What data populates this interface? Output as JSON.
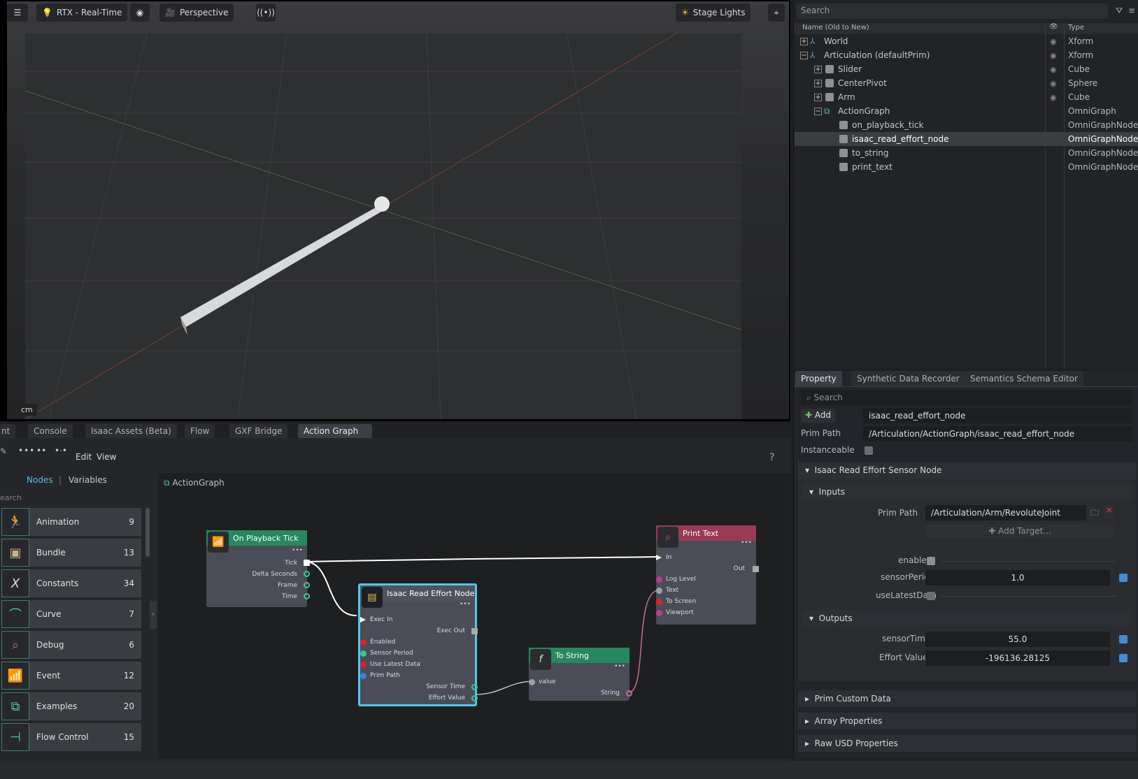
{
  "viewport": {
    "render_mode": "RTX - Real-Time",
    "camera": "Perspective",
    "lights": "Stage Lights",
    "unit": "cm"
  },
  "stage": {
    "search_placeholder": "Search",
    "col_name": "Name (Old to New)",
    "col_type": "Type",
    "rows": [
      {
        "name": "World",
        "type": "Xform"
      },
      {
        "name": "Articulation (defaultPrim)",
        "type": "Xform"
      },
      {
        "name": "Slider",
        "type": "Cube"
      },
      {
        "name": "CenterPivot",
        "type": "Sphere"
      },
      {
        "name": "Arm",
        "type": "Cube"
      },
      {
        "name": "ActionGraph",
        "type": "OmniGraph"
      },
      {
        "name": "on_playback_tick",
        "type": "OmniGraphNode"
      },
      {
        "name": "isaac_read_effort_node",
        "type": "OmniGraphNode"
      },
      {
        "name": "to_string",
        "type": "OmniGraphNode"
      },
      {
        "name": "print_text",
        "type": "OmniGraphNode"
      }
    ]
  },
  "property": {
    "tabs": [
      "Property",
      "Synthetic Data Recorder",
      "Semantics Schema Editor"
    ],
    "search_placeholder": "Search",
    "add_label": "Add",
    "name_value": "isaac_read_effort_node",
    "prim_path_label": "Prim Path",
    "prim_path_value": "/Articulation/ActionGraph/isaac_read_effort_node",
    "instanceable_label": "Instanceable",
    "section_title": "Isaac Read Effort Sensor Node",
    "inputs_label": "Inputs",
    "input_prim_path_label": "Prim Path",
    "input_prim_path_value": "/Articulation/Arm/RevoluteJoint",
    "add_target_label": "Add Target...",
    "enabled_label": "enabled",
    "sensor_period_label": "sensorPeriod",
    "sensor_period_value": "1.0",
    "use_latest_label": "useLatestData",
    "outputs_label": "Outputs",
    "sensor_time_label": "sensorTime",
    "sensor_time_value": "55.0",
    "effort_label": "Effort Value",
    "effort_value": "-196136.28125",
    "collapsed_sections": [
      "Prim Custom Data",
      "Array Properties",
      "Raw USD Properties"
    ]
  },
  "bottom_tabs": [
    "nt",
    "Console",
    "Isaac Assets (Beta)",
    "Flow",
    "GXF Bridge",
    "Action Graph"
  ],
  "graph_editor": {
    "menu_edit": "Edit",
    "menu_view": "View",
    "help": "?",
    "nodes_tab": "Nodes",
    "separator": "|",
    "variables_tab": "Variables",
    "search_placeholder": "earch",
    "breadcrumb": "ActionGraph",
    "categories": [
      {
        "name": "Animation",
        "count": "9",
        "icon": "running-person-icon"
      },
      {
        "name": "Bundle",
        "count": "13",
        "icon": "box-icon"
      },
      {
        "name": "Constants",
        "count": "34",
        "icon": "x-icon"
      },
      {
        "name": "Curve",
        "count": "7",
        "icon": "curve-icon"
      },
      {
        "name": "Debug",
        "count": "6",
        "icon": "bug-icon"
      },
      {
        "name": "Event",
        "count": "12",
        "icon": "signal-icon"
      },
      {
        "name": "Examples",
        "count": "20",
        "icon": "examples-icon"
      },
      {
        "name": "Flow Control",
        "count": "15",
        "icon": "flow-icon"
      }
    ],
    "nodes": {
      "tick": {
        "title": "On Playback Tick",
        "ports": [
          "Tick",
          "Delta Seconds",
          "Frame",
          "Time"
        ]
      },
      "effort": {
        "title": "Isaac Read Effort Node",
        "ins": [
          "Exec In",
          "Enabled",
          "Sensor Period",
          "Use Latest Data",
          "Prim Path"
        ],
        "outs": [
          "Exec Out",
          "Sensor Time",
          "Effort Value"
        ]
      },
      "tostring": {
        "title": "To String",
        "in": "value",
        "out": "String"
      },
      "print": {
        "title": "Print Text",
        "ins": [
          "In",
          "Log Level",
          "Text",
          "To Screen",
          "Viewport"
        ],
        "out": "Out"
      }
    }
  }
}
